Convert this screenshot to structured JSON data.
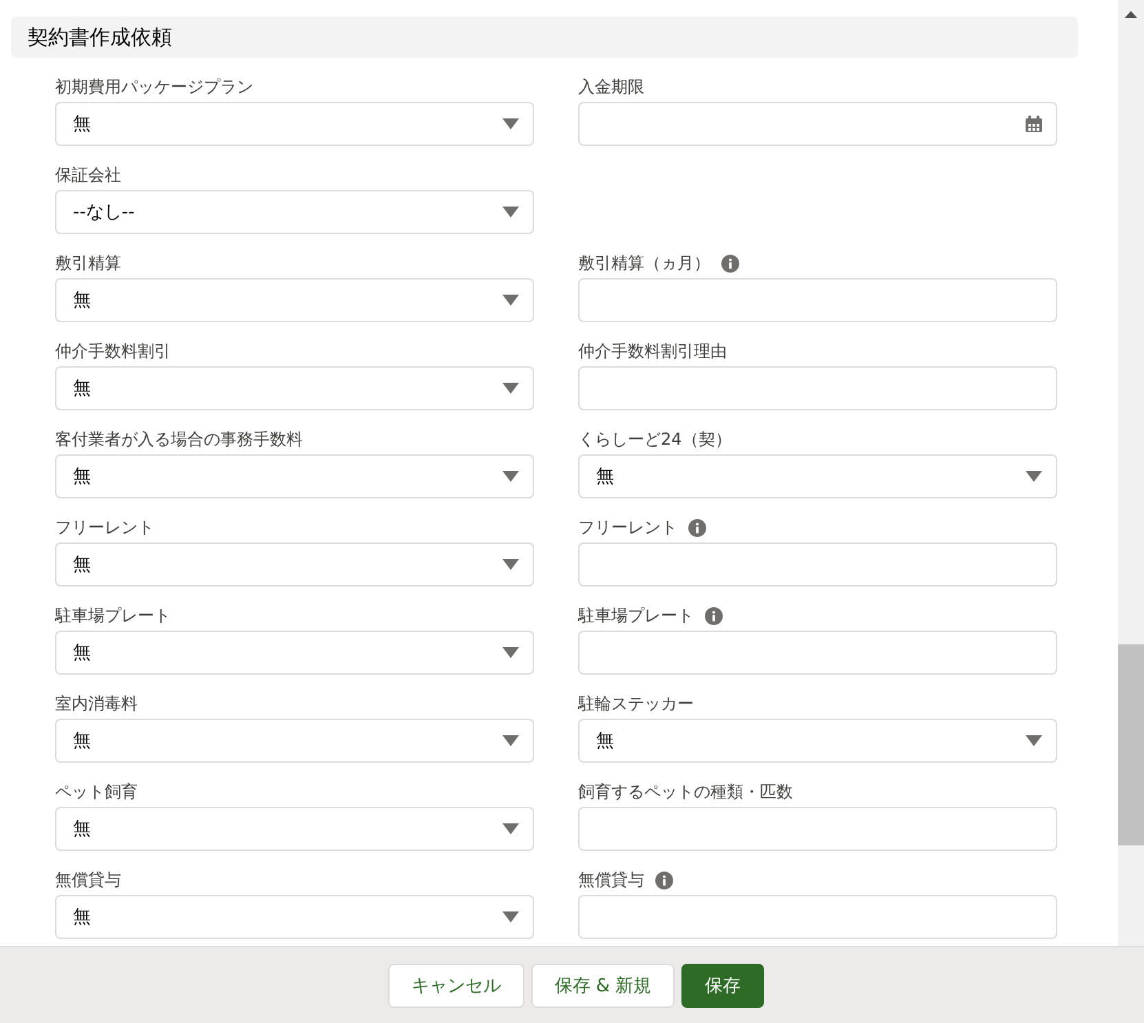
{
  "section": {
    "title": "契約書作成依頼"
  },
  "rows": [
    {
      "fields": [
        {
          "label": "初期費用パッケージプラン",
          "kind": "select",
          "value": "無"
        },
        {
          "label": "入金期限",
          "kind": "date"
        }
      ]
    },
    {
      "fields": [
        {
          "label": "保証会社",
          "kind": "select",
          "value": "--なし--"
        }
      ]
    },
    {
      "fields": [
        {
          "label": "敷引精算",
          "kind": "select",
          "value": "無"
        },
        {
          "label": "敷引精算（ヵ月）",
          "kind": "text",
          "info": true
        }
      ]
    },
    {
      "fields": [
        {
          "label": "仲介手数料割引",
          "kind": "select",
          "value": "無"
        },
        {
          "label": "仲介手数料割引理由",
          "kind": "text"
        }
      ]
    },
    {
      "fields": [
        {
          "label": "客付業者が入る場合の事務手数料",
          "kind": "select",
          "value": "無"
        },
        {
          "label": "くらしーど24（契）",
          "kind": "select",
          "value": "無"
        }
      ]
    },
    {
      "fields": [
        {
          "label": "フリーレント",
          "kind": "select",
          "value": "無"
        },
        {
          "label": "フリーレント",
          "kind": "text",
          "info": true
        }
      ]
    },
    {
      "fields": [
        {
          "label": "駐車場プレート",
          "kind": "select",
          "value": "無"
        },
        {
          "label": "駐車場プレート",
          "kind": "text",
          "info": true
        }
      ]
    },
    {
      "fields": [
        {
          "label": "室内消毒料",
          "kind": "select",
          "value": "無"
        },
        {
          "label": "駐輪ステッカー",
          "kind": "select",
          "value": "無"
        }
      ]
    },
    {
      "fields": [
        {
          "label": "ペット飼育",
          "kind": "select",
          "value": "無"
        },
        {
          "label": "飼育するペットの種類・匹数",
          "kind": "text"
        }
      ]
    },
    {
      "fields": [
        {
          "label": "無償貸与",
          "kind": "select",
          "value": "無"
        },
        {
          "label": "無償貸与",
          "kind": "text",
          "info": true
        }
      ]
    }
  ],
  "footer": {
    "buttons": [
      {
        "label": "キャンセル",
        "kind": "neutral"
      },
      {
        "label": "保存 & 新規",
        "kind": "neutral"
      },
      {
        "label": "保存",
        "kind": "brand"
      }
    ]
  }
}
